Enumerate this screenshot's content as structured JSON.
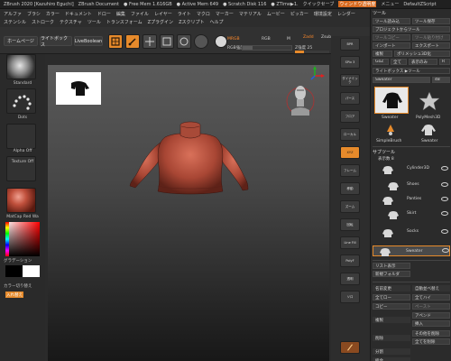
{
  "titlebar": {
    "app": "ZBrush 2020 [Kazuhiro Eguchi]",
    "doc": "ZBrush Document",
    "free_mem": "● Free Mem 1.616GB",
    "active_mem": "● Active Mem 649",
    "scratch": "● Scratch Disk 116",
    "ztime": "● ZTime▶1.",
    "quicksave": "クイックセーブ",
    "window_transparency": "ウィンドウ透明度",
    "menus": "メニュー",
    "script": "DefaultZScript"
  },
  "menus": {
    "row1": [
      "アルファ",
      "ブラシ",
      "カラー",
      "ドキュメント",
      "ドロー",
      "編集",
      "ファイル",
      "レイヤー",
      "ライト",
      "マクロ",
      "マーカー",
      "マテリアル",
      "ムービー",
      "ピッカー",
      "環境設定",
      "レンダー"
    ],
    "row2": [
      "ステンシル",
      "ストローク",
      "テクスチャ",
      "ツール",
      "トランスフォーム",
      "Zプラグイン",
      "Zスクリプト",
      "ヘルプ"
    ]
  },
  "shelf": {
    "home": "ホームページ",
    "lightbox": "ライトボックス",
    "liveboolean": "LiveBoolean",
    "edit": "Edit",
    "draw": "Draw",
    "move": "Move",
    "scale": "Scale",
    "rotate": "Rotate",
    "mrgb": "MRGB",
    "rgb": "RGB",
    "m": "M",
    "zadd": "Zadd",
    "zsub": "Zsub",
    "rgb_intensity": "RGB強度",
    "z_intensity": "Z強度 25"
  },
  "left": {
    "brush": "Standard",
    "stroke": "Dots",
    "alpha": "Alpha Off",
    "texture": "Texture Off",
    "material": "MatCap Red Wa",
    "gradient": "グラデーション",
    "switch_color": "カラー切り替え",
    "swap": "入れ替え"
  },
  "rstrip": {
    "bpr": "BPR",
    "spix": "SPix 3",
    "dynamic": "ダイナミック",
    "persp": "パース",
    "floor": "フロア",
    "local": "ローカル",
    "xyz": "XYZ",
    "frame": "フレーム",
    "move": "移動",
    "zoom": "ズーム",
    "rotate": "回転",
    "linefill": "Line Fill",
    "polyf": "PolyF",
    "transp": "透明",
    "solo": "ソロ"
  },
  "panel": {
    "header": "ツール",
    "btn_load": "ツール読み込",
    "btn_save": "ツール保存",
    "btn_project_load": "プロジェクトからツール",
    "btn_copy": "ツールコピー",
    "btn_paste": "ツール貼り付け",
    "btn_import": "インポート",
    "btn_export": "エクスポート",
    "btn_clone": "複製",
    "btn_make_polymesh": "ポリメッシュ3D化",
    "btn_goz": "GoZ",
    "btn_all": "全て",
    "btn_visible": "表示のみ",
    "btn_r": "R",
    "lightbox_tool": "ライトボックス ▶ツール",
    "tool_name": "Sweater",
    "tool_count": "48",
    "t1": "Sweater",
    "t2": "PolyMesh3D",
    "t3": "SimpleBrush",
    "t4": "Sweater",
    "subtool": "サブツール",
    "visible_count": "表示数 8",
    "items": [
      "Cylinder3D",
      "Shoes",
      "Panties",
      "Skirt",
      "Socks",
      "Sweater"
    ],
    "list_all": "リスト表示",
    "new_folder": "新規フォルダ",
    "rename": "名前変更",
    "auto_reorder": "自動並べ替え",
    "all_low": "全てロー",
    "all_high": "全てハイ",
    "copy": "コピー",
    "paste": "ペースト",
    "append": "アペンド",
    "duplicate": "複製",
    "insert": "挿入",
    "delete": "削除",
    "delete_other": "その他を削除",
    "delete_all": "全てを削除",
    "split": "分割",
    "merge": "統合"
  },
  "colors": {
    "accent": "#e68a2b",
    "sweater": "#b5533f",
    "viewport_top": "#5a5a5a"
  }
}
